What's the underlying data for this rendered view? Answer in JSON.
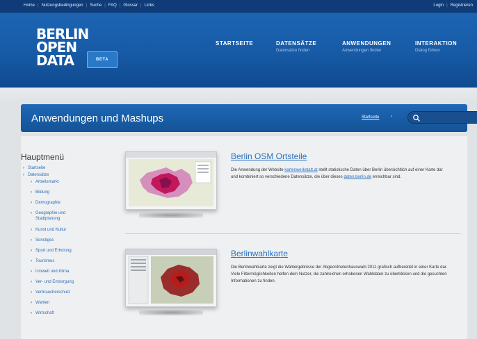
{
  "topbar": {
    "links": [
      "Home",
      "Nutzungsbedingungen",
      "Suche",
      "FAQ",
      "Glossar",
      "Links"
    ],
    "login": "Login",
    "register": "Registrieren"
  },
  "header": {
    "logo_line1": "BERLIN",
    "logo_line2": "OPEN",
    "logo_line3": "DATA",
    "beta_label": "BETA",
    "nav": [
      {
        "title": "STARTSEITE",
        "subtitle": ""
      },
      {
        "title": "DATENSÄTZE",
        "subtitle": "Datensätze finden"
      },
      {
        "title": "ANWENDUNGEN",
        "subtitle": "Anwendungen finden"
      },
      {
        "title": "INTERAKTION",
        "subtitle": "Dialog führen"
      }
    ]
  },
  "page": {
    "title": "Anwendungen und Mashups",
    "breadcrumb": "Startseite",
    "breadcrumb_arrow": "›"
  },
  "sidebar": {
    "heading": "Hauptmenü",
    "items": [
      {
        "label": "Startseite",
        "level": 1
      },
      {
        "label": "Datensätze",
        "level": 1
      },
      {
        "label": "Arbeitsmarkt",
        "level": 2
      },
      {
        "label": "Bildung",
        "level": 2
      },
      {
        "label": "Demographie",
        "level": 2
      },
      {
        "label": "Geographie und Stadtplanung",
        "level": 2
      },
      {
        "label": "Kunst und Kultur",
        "level": 2
      },
      {
        "label": "Sonstiges",
        "level": 2
      },
      {
        "label": "Sport und Erholung",
        "level": 2
      },
      {
        "label": "Tourismus",
        "level": 2
      },
      {
        "label": "Umwelt und Klima",
        "level": 2
      },
      {
        "label": "Ver- und Entsorgung",
        "level": 2
      },
      {
        "label": "Verbraucherschutz",
        "level": 2
      },
      {
        "label": "Wahlen",
        "level": 2
      },
      {
        "label": "Wirtschaft",
        "level": 2
      }
    ]
  },
  "apps": [
    {
      "title": "Berlin OSM Ortsteile",
      "text_before": "Die Anwendung der Website ",
      "link1": "kartenwerkstatt.at",
      "text_middle": " stellt statistische Daten über Berlin übersichtlich auf einer Karte dar und kombiniert so verschiedene Datensätze, die über dieses ",
      "link2": "daten.berlin.de",
      "text_after": " erreichbar sind."
    },
    {
      "title": "Berlinwahlkarte",
      "text": "Die Berlinwahlkarte zeigt die Wahlergebnisse der Abgeordnetenhauswahl 2011 grafisch aufbereitet in einer Karte dar. Viele Filtermöglichkeiten helfen dem Nutzer, die zahlreichen erhobenen Wahldaten zu überblicken und die gesuchten Informationen zu finden."
    }
  ],
  "colors": {
    "header_blue": "#1c65b3",
    "topbar_blue": "#0f3c78",
    "link_blue": "#2a72c0",
    "map_magenta": "#c2185b",
    "map_red": "#b71c1c"
  },
  "icons": {
    "search": "search-icon",
    "chevron": "chevron-right-icon"
  }
}
